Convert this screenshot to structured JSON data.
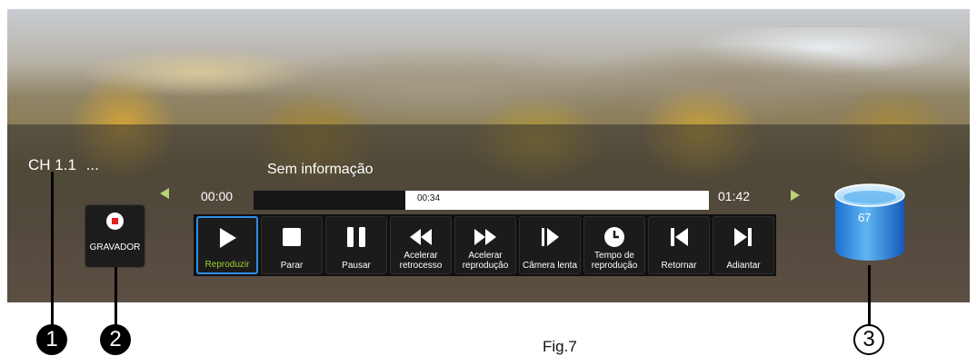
{
  "channel": {
    "label": "CH 1.1",
    "more": "..."
  },
  "program": {
    "title": "Sem informação"
  },
  "timeline": {
    "start": "00:00",
    "current": "00:34",
    "end": "01:42",
    "progress_fraction": 0.333
  },
  "record_button": {
    "label": "GRAVADOR",
    "icon": "record-icon"
  },
  "controls": [
    {
      "id": "play",
      "label": "Reproduzir",
      "icon": "play-icon",
      "active": true
    },
    {
      "id": "stop",
      "label": "Parar",
      "icon": "stop-icon",
      "active": false
    },
    {
      "id": "pause",
      "label": "Pausar",
      "icon": "pause-icon",
      "active": false
    },
    {
      "id": "rewind",
      "label": "Acelerar retrocesso",
      "icon": "rewind-icon",
      "active": false
    },
    {
      "id": "fastforward",
      "label": "Acelerar reprodução",
      "icon": "fast-forward-icon",
      "active": false
    },
    {
      "id": "slowmo",
      "label": "Câmera lenta",
      "icon": "slow-motion-icon",
      "active": false
    },
    {
      "id": "playtime",
      "label": "Tempo de reprodução",
      "icon": "clock-icon",
      "active": false
    },
    {
      "id": "previous",
      "label": "Retornar",
      "icon": "skip-back-icon",
      "active": false
    },
    {
      "id": "next",
      "label": "Adiantar",
      "icon": "skip-forward-icon",
      "active": false
    }
  ],
  "storage": {
    "value": "67",
    "icon": "disk-icon"
  },
  "callouts": [
    "1",
    "2",
    "3"
  ],
  "caption": "Fig.7",
  "colors": {
    "accent": "#2d8fe6",
    "active_label": "#a2d12e",
    "arrow": "#b9d27a",
    "record": "#e0201f"
  }
}
